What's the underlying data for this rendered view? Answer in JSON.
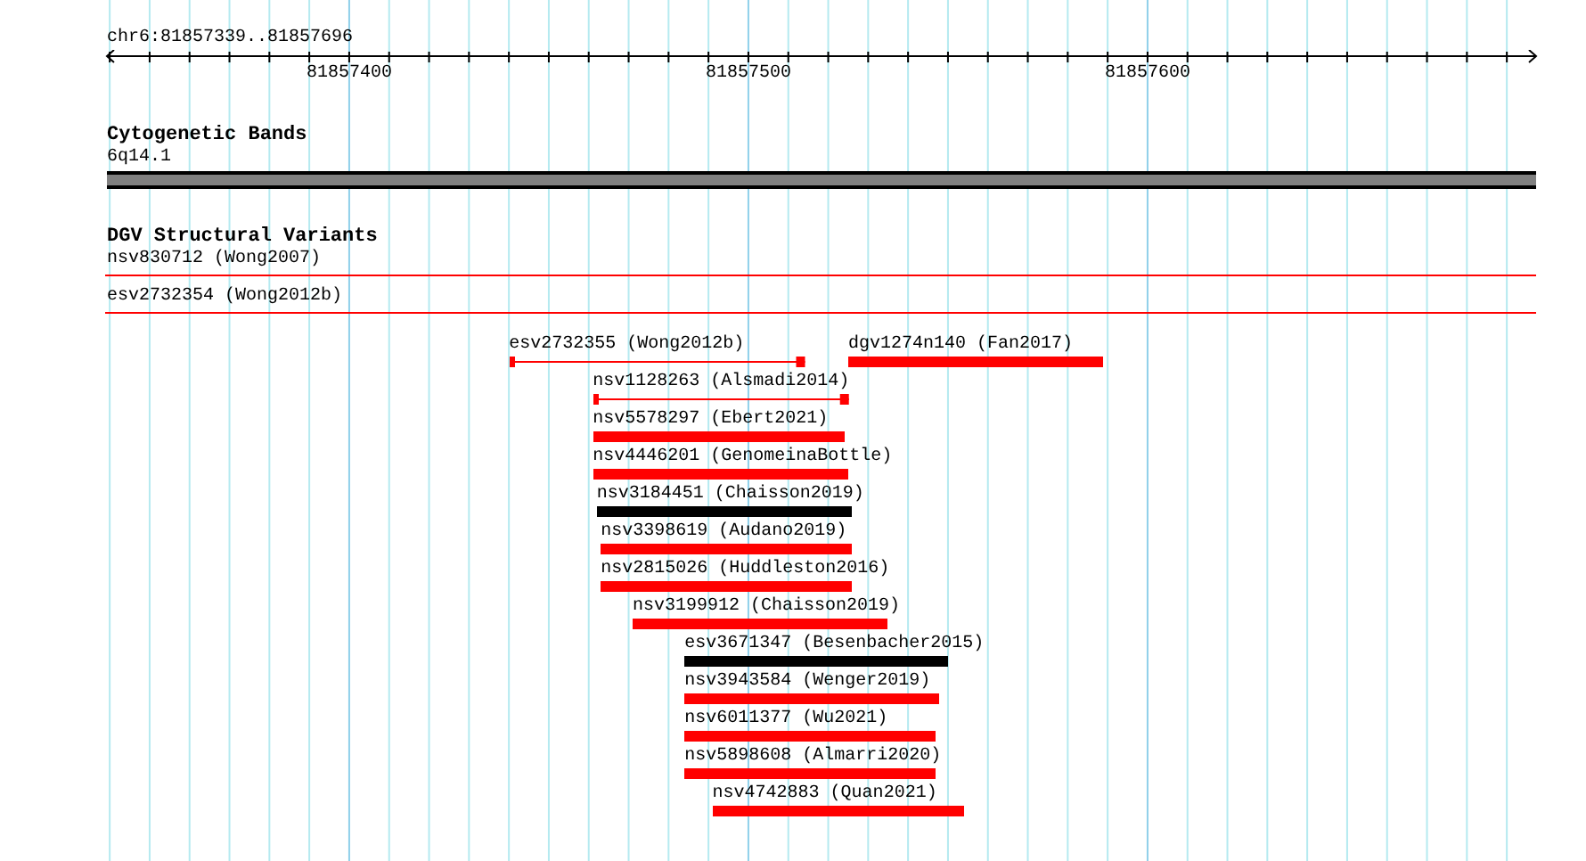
{
  "ruler": {
    "location": "chr6:81857339..81857696",
    "ticks": [
      {
        "label": "81857400"
      },
      {
        "label": "81857500"
      },
      {
        "label": "81857600"
      }
    ]
  },
  "cytogenetic_bands": {
    "title": "Cytogenetic Bands",
    "band": "6q14.1"
  },
  "dgv": {
    "title": "DGV Structural Variants",
    "spanning_features": [
      {
        "label": "nsv830712 (Wong2007)"
      },
      {
        "label": "esv2732354 (Wong2012b)"
      }
    ],
    "rows": [
      {
        "features": [
          {
            "label": "esv2732355 (Wong2012b)",
            "kind": "line",
            "color": "#ff0000"
          },
          {
            "label": "dgv1274n140 (Fan2017)",
            "kind": "bar",
            "color": "#ff0000"
          }
        ]
      },
      {
        "features": [
          {
            "label": "nsv1128263 (Alsmadi2014)",
            "kind": "line",
            "color": "#ff0000"
          }
        ]
      },
      {
        "features": [
          {
            "label": "nsv5578297 (Ebert2021)",
            "kind": "bar",
            "color": "#ff0000"
          }
        ]
      },
      {
        "features": [
          {
            "label": "nsv4446201 (GenomeinaBottle)",
            "kind": "bar",
            "color": "#ff0000"
          }
        ]
      },
      {
        "features": [
          {
            "label": "nsv3184451 (Chaisson2019)",
            "kind": "bar",
            "color": "#000000"
          }
        ]
      },
      {
        "features": [
          {
            "label": "nsv3398619 (Audano2019)",
            "kind": "bar",
            "color": "#ff0000"
          }
        ]
      },
      {
        "features": [
          {
            "label": "nsv2815026 (Huddleston2016)",
            "kind": "bar",
            "color": "#ff0000"
          }
        ]
      },
      {
        "features": [
          {
            "label": "nsv3199912 (Chaisson2019)",
            "kind": "bar",
            "color": "#ff0000"
          }
        ]
      },
      {
        "features": [
          {
            "label": "esv3671347 (Besenbacher2015)",
            "kind": "bar",
            "color": "#000000"
          }
        ]
      },
      {
        "features": [
          {
            "label": "nsv3943584 (Wenger2019)",
            "kind": "bar",
            "color": "#ff0000"
          }
        ]
      },
      {
        "features": [
          {
            "label": "nsv6011377 (Wu2021)",
            "kind": "bar",
            "color": "#ff0000"
          }
        ]
      },
      {
        "features": [
          {
            "label": "nsv5898608 (Almarri2020)",
            "kind": "bar",
            "color": "#ff0000"
          }
        ]
      },
      {
        "features": [
          {
            "label": "nsv4742883 (Quan2021)",
            "kind": "bar",
            "color": "#ff0000"
          }
        ]
      }
    ]
  }
}
